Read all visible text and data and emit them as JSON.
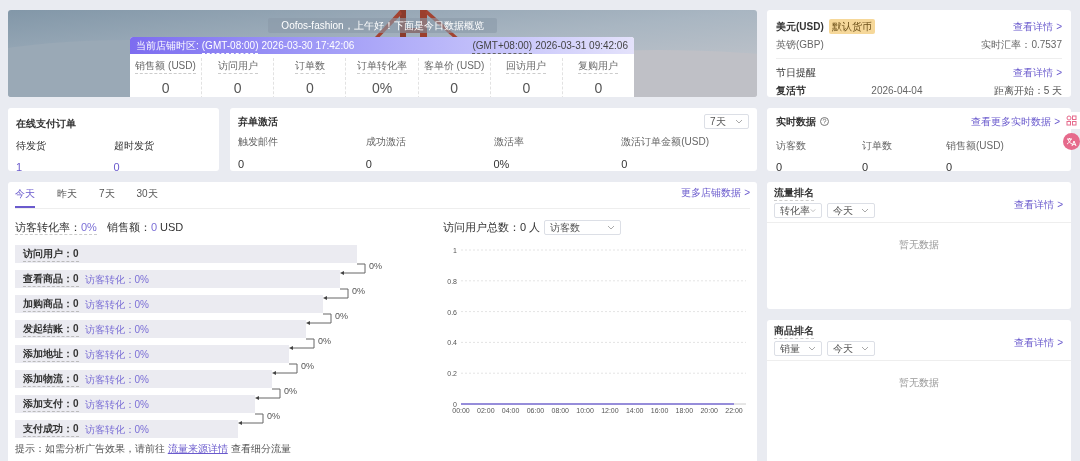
{
  "banner": {
    "greeting": "Oofos-fashion，上午好！下面是今日数据概览",
    "store_tz_label": "当前店铺时区:",
    "store_tz": "(GMT-08:00)",
    "store_time": "2026-03-30 17:42:06",
    "local_tz": "(GMT+08:00)",
    "local_time": "2026-03-31 09:42:06",
    "metrics": [
      {
        "label": "销售额 (USD)",
        "value": "0"
      },
      {
        "label": "访问用户",
        "value": "0"
      },
      {
        "label": "订单数",
        "value": "0"
      },
      {
        "label": "订单转化率",
        "value": "0%"
      },
      {
        "label": "客单价 (USD)",
        "value": "0"
      },
      {
        "label": "回访用户",
        "value": "0"
      },
      {
        "label": "复购用户",
        "value": "0"
      }
    ]
  },
  "online_orders": {
    "title": "在线支付订单",
    "items": [
      {
        "label": "待发货",
        "value": "1"
      },
      {
        "label": "超时发货",
        "value": "0"
      }
    ]
  },
  "abandoned": {
    "title": "弃单激活",
    "select": "7天",
    "items": [
      {
        "label": "触发邮件",
        "value": "0"
      },
      {
        "label": "成功激活",
        "value": "0"
      },
      {
        "label": "激活率",
        "value": "0%"
      },
      {
        "label": "激活订单金额(USD)",
        "value": "0"
      }
    ]
  },
  "store_data": {
    "tabs": [
      {
        "label": "今天",
        "selected": true
      },
      {
        "label": "昨天",
        "selected": false
      },
      {
        "label": "7天",
        "selected": false
      },
      {
        "label": "30天",
        "selected": false
      }
    ],
    "link": "更多店铺数据 >",
    "conversion_label": "访客转化率：",
    "conversion": "0%",
    "sales_label": "销售额：",
    "sales": "0",
    "sales_unit": "USD",
    "funnel": [
      {
        "label": "访问用户：",
        "value": "0",
        "step_rate": "0%"
      },
      {
        "label": "查看商品：",
        "value": "0",
        "conversion": "访客转化：0%",
        "step_rate": "0%"
      },
      {
        "label": "加购商品：",
        "value": "0",
        "conversion": "访客转化：0%",
        "step_rate": "0%"
      },
      {
        "label": "发起结账：",
        "value": "0",
        "conversion": "访客转化：0%",
        "step_rate": "0%"
      },
      {
        "label": "添加地址：",
        "value": "0",
        "conversion": "访客转化：0%",
        "step_rate": "0%"
      },
      {
        "label": "添加物流：",
        "value": "0",
        "conversion": "访客转化：0%",
        "step_rate": "0%"
      },
      {
        "label": "添加支付：",
        "value": "0",
        "conversion": "访客转化：0%",
        "step_rate": "0%"
      },
      {
        "label": "支付成功：",
        "value": "0",
        "conversion": "访客转化：0%"
      }
    ],
    "note": "提示：如需分析广告效果，请前往",
    "note_link": "流量来源详情",
    "note_after": "查看细分流量",
    "visitors_label": "访问用户总数：",
    "visitors": "0 人",
    "visitors_select": "访客数",
    "chart_data": {
      "type": "line",
      "categories": [
        "00:00",
        "02:00",
        "04:00",
        "06:00",
        "08:00",
        "10:00",
        "12:00",
        "14:00",
        "16:00",
        "18:00",
        "20:00",
        "22:00"
      ],
      "ylim": [
        0,
        1
      ],
      "grid": true,
      "yticks": [
        0,
        0.2,
        0.4,
        0.6,
        0.8,
        1
      ],
      "series": [
        {
          "color": "#7b6fd6",
          "values": [
            0,
            0,
            0,
            0,
            0,
            0,
            0,
            0,
            0,
            0,
            0,
            0
          ]
        }
      ]
    }
  },
  "currency": {
    "name": "美元(USD)",
    "badge": "默认货币",
    "link": "查看详情 >",
    "other": "英镑(GBP)",
    "rate": "实时汇率：0.7537"
  },
  "holiday": {
    "title": "节日提醒",
    "link": "查看详情 >",
    "name": "复活节",
    "date": "2026-04-04",
    "countdown": "距离开始：5 天"
  },
  "realtime": {
    "title": "实时数据",
    "link": "查看更多实时数据 >",
    "items": [
      {
        "label": "访客数",
        "value": "0"
      },
      {
        "label": "订单数",
        "value": "0"
      },
      {
        "label": "销售额(USD)",
        "value": "0"
      }
    ]
  },
  "traffic_rank": {
    "title": "流量排名",
    "selects": [
      "转化率",
      "今天"
    ],
    "link": "查看详情 >",
    "empty": "暂无数据"
  },
  "product_rank": {
    "title": "商品排名",
    "selects": [
      "销量",
      "今天"
    ],
    "link": "查看详情 >",
    "empty": "暂无数据"
  }
}
